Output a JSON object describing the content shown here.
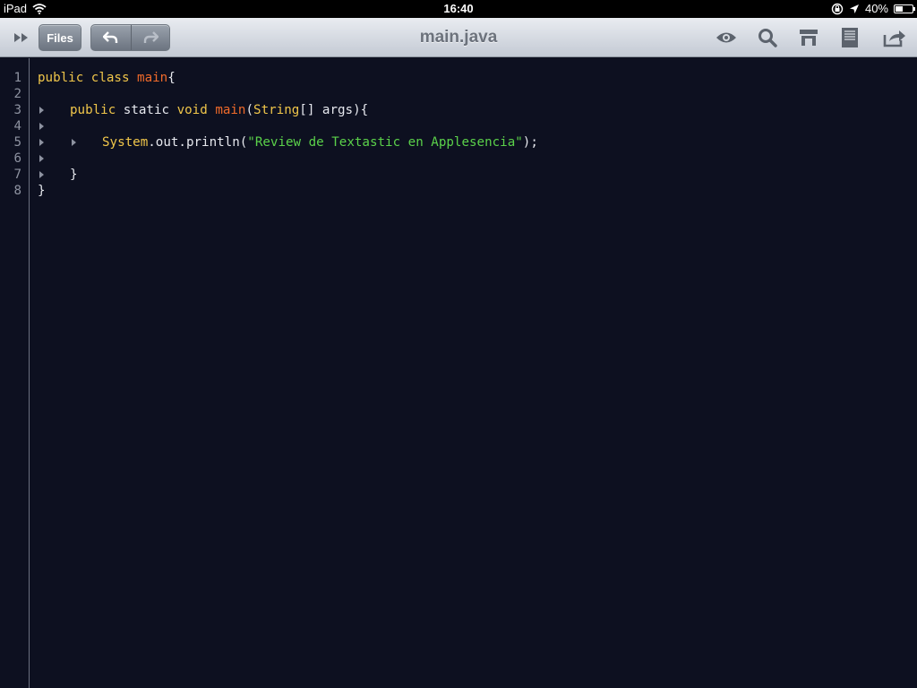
{
  "status_bar": {
    "device": "iPad",
    "time": "16:40",
    "battery": "40%",
    "battery_level": 0.4
  },
  "toolbar": {
    "files_label": "Files",
    "title": "main.java",
    "icons": [
      "expand-icon",
      "undo-icon",
      "redo-icon",
      "preview-eye-icon",
      "search-icon",
      "symbols-icon",
      "document-icon",
      "share-icon"
    ]
  },
  "editor": {
    "line_numbers": [
      "1",
      "2",
      "3",
      "4",
      "5",
      "6",
      "7",
      "8"
    ],
    "lines": [
      {
        "indent": 0,
        "tokens": [
          {
            "t": "public class ",
            "c": "kw"
          },
          {
            "t": "main",
            "c": "fn"
          },
          {
            "t": "{",
            "c": "plain"
          }
        ]
      },
      {
        "indent": 0,
        "tokens": []
      },
      {
        "indent": 1,
        "tokens": [
          {
            "t": "public ",
            "c": "kw"
          },
          {
            "t": "static ",
            "c": "plain"
          },
          {
            "t": "void ",
            "c": "kw"
          },
          {
            "t": "main",
            "c": "fn"
          },
          {
            "t": "(",
            "c": "plain"
          },
          {
            "t": "String",
            "c": "cls"
          },
          {
            "t": "[] args){",
            "c": "plain"
          }
        ]
      },
      {
        "indent": 1,
        "tokens": []
      },
      {
        "indent": 2,
        "tokens": [
          {
            "t": "System",
            "c": "cls"
          },
          {
            "t": ".out.println(",
            "c": "plain"
          },
          {
            "t": "\"Review de Textastic en Applesencia\"",
            "c": "str"
          },
          {
            "t": ");",
            "c": "plain"
          }
        ]
      },
      {
        "indent": 1,
        "tokens": []
      },
      {
        "indent": 1,
        "tokens": [
          {
            "t": "}",
            "c": "plain"
          }
        ]
      },
      {
        "indent": 0,
        "tokens": [
          {
            "t": "}",
            "c": "plain"
          }
        ]
      }
    ]
  }
}
